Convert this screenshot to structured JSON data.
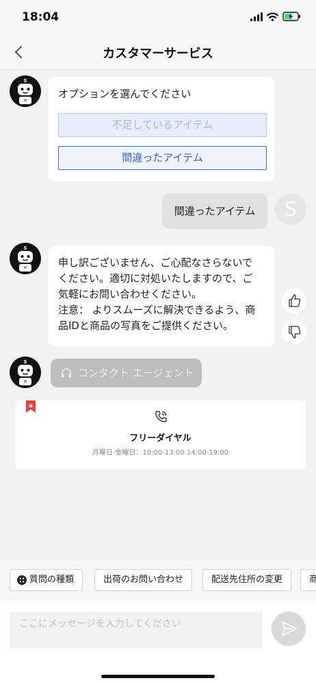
{
  "status_bar": {
    "time": "18:04"
  },
  "header": {
    "title": "カスタマーサービス"
  },
  "chat": {
    "bot_options": {
      "prompt": "オプションを選んでください",
      "options": [
        "不足しているアイテム",
        "間違ったアイテム"
      ]
    },
    "user_message": {
      "text": "間違ったアイテム",
      "avatar_initial": "S"
    },
    "bot_reply": {
      "lines": [
        "申し訳ございません、ご心配なさらないで",
        "ください。適切に対処いたしますので、ご",
        "気軽にお問い合わせください。",
        "注意： よりスムーズに解決できるよう、商",
        "品IDと商品の写真をご提供ください。"
      ]
    },
    "contact_agent_label": "コンタクト エージェント",
    "hotline_card": {
      "title": "フリーダイヤル",
      "hours": "月曜日-金曜日：10:00-13:00 14:00-19:00"
    }
  },
  "quick_actions": [
    "質問の種類",
    "出荷のお問い合わせ",
    "配送先住所の変更",
    "商"
  ],
  "composer": {
    "placeholder": "ここにメッセージを入力してください"
  },
  "colors": {
    "accent": "#3f66c8",
    "flag": "#e8413f"
  }
}
